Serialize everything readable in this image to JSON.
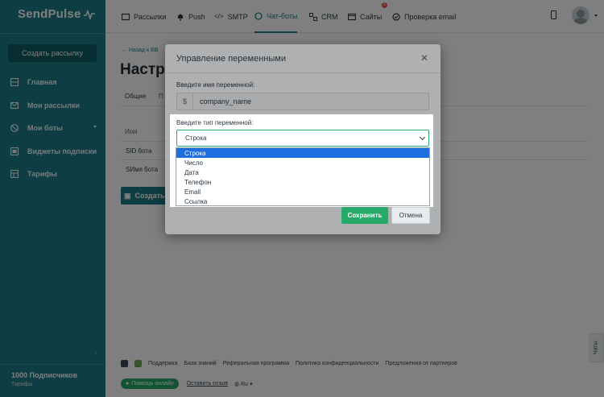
{
  "brand": {
    "name": "SendPulse"
  },
  "sidebar": {
    "create_button": "Создать рассылку",
    "items": [
      {
        "label": "Главная",
        "icon": "grid-icon"
      },
      {
        "label": "Мои рассылки",
        "icon": "mail-icon"
      },
      {
        "label": "Мои боты",
        "icon": "bot-icon"
      },
      {
        "label": "Виджеты подписки",
        "icon": "widget-icon"
      },
      {
        "label": "Тарифы",
        "icon": "tariff-icon"
      }
    ],
    "subscribers": "1000 Подписчиков",
    "plan_link": "Тарифы"
  },
  "topnav": {
    "items": [
      {
        "label": "Рассылки",
        "icon": "mail-icon"
      },
      {
        "label": "Push",
        "icon": "bell-icon"
      },
      {
        "label": "SMTP",
        "icon": "code-icon"
      },
      {
        "label": "Чат-боты",
        "icon": "chat-icon",
        "active": true
      },
      {
        "label": "CRM",
        "icon": "crm-icon"
      },
      {
        "label": "Сайты",
        "icon": "site-icon",
        "badge": "2"
      },
      {
        "label": "Проверка email",
        "icon": "check-icon"
      }
    ]
  },
  "page": {
    "back_link": "← Назад к ВВ",
    "title": "Настро",
    "tab_general": "Общие",
    "tab_active": "П",
    "col_name": "Имя",
    "rows": [
      "SID бота",
      "SИмя бота"
    ],
    "create_button": "Создать"
  },
  "footer": {
    "links": [
      "Поддержка",
      "База знаний",
      "Реферальная программа",
      "Политика конфиденциальности",
      "Предложения от партнеров"
    ],
    "help_button": "Помощь онлайн",
    "feedback": "Оставить отзыв",
    "language": "Ru",
    "chats_tab": "Чаты"
  },
  "modal": {
    "title": "Управление переменными",
    "name_label": "Введите имя переменной:",
    "name_prefix": "$",
    "name_value": "company_name",
    "type_label": "Введите тип переменной:",
    "type_value": "Строка",
    "type_options": [
      "Строка",
      "Число",
      "Дата",
      "Телефон",
      "Email",
      "Ссылка"
    ],
    "selected_option_index": 0,
    "save_button": "Сохранить",
    "cancel_button": "Отмена"
  },
  "colors": {
    "sidebar": "#1c7d86",
    "accent_green": "#27a96a",
    "selection_blue": "#1d6fe0"
  }
}
